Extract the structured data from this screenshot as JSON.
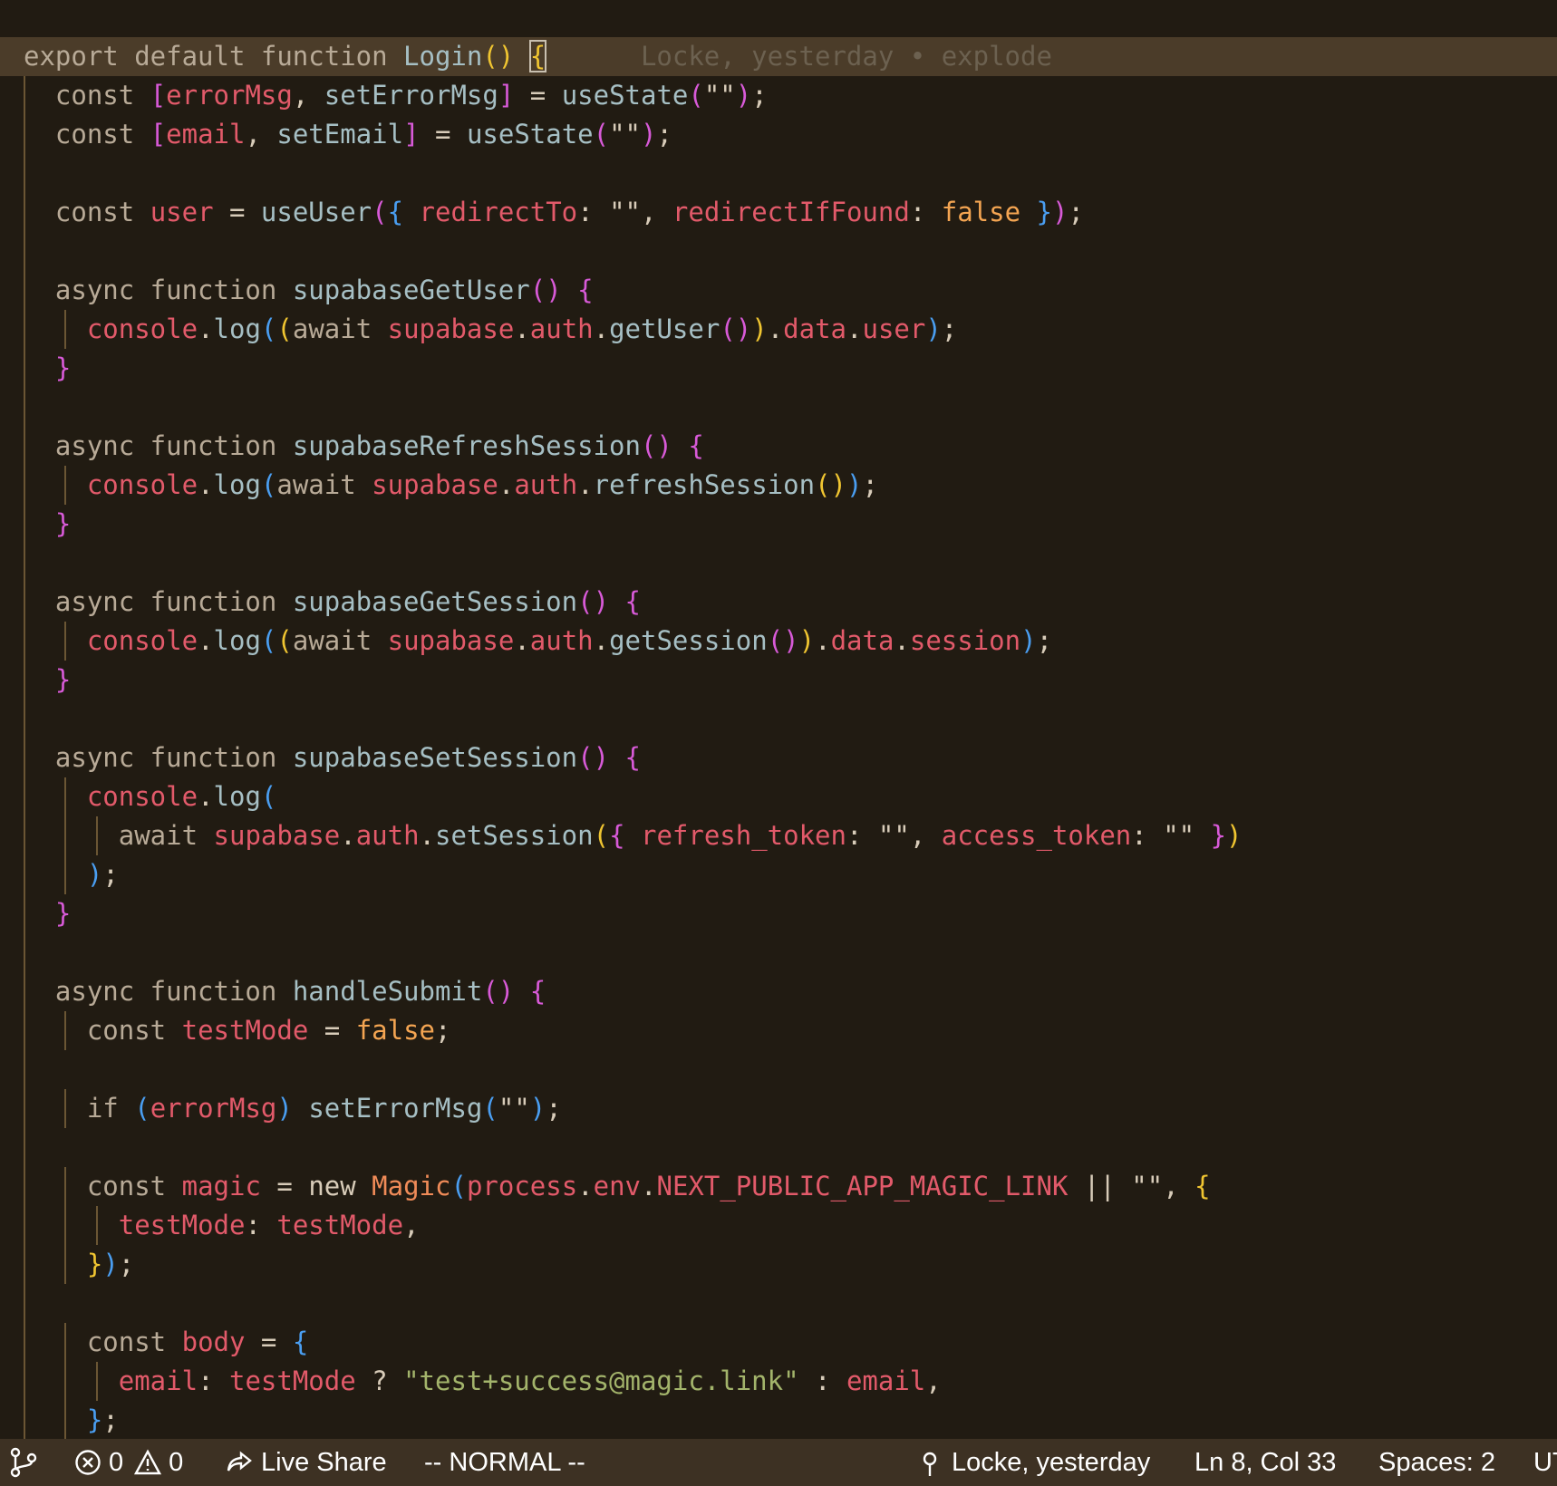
{
  "theme": {
    "bg": "#211b12",
    "current_line_bg": "#4b3c29",
    "statusbar_bg": "#3d3123",
    "keyword": "#b8aa97",
    "plain": "#d8ccb9",
    "func": "#a6bfc4",
    "var": "#e25a6a",
    "bool": "#f4a552",
    "string": "#d8ccb9",
    "string_green": "#a3b46b",
    "bracket_yellow": "#f0c531",
    "bracket_magenta": "#d85ad8",
    "bracket_blue": "#4a9ef1",
    "class": "#f08b58"
  },
  "editor": {
    "blame_inline": "Locke, yesterday • explode",
    "lines": [
      {
        "indent": 0,
        "current": true,
        "tokens": [
          [
            "export default function ",
            "keyword"
          ],
          [
            "Login",
            "func"
          ],
          [
            "()",
            "bracket_yellow"
          ],
          [
            " ",
            "plain"
          ],
          [
            "{",
            "bracket_yellow",
            "cursor"
          ]
        ]
      },
      {
        "indent": 1,
        "tokens": [
          [
            "const ",
            "keyword"
          ],
          [
            "[",
            "bracket_magenta"
          ],
          [
            "errorMsg",
            "var"
          ],
          [
            ", ",
            "plain"
          ],
          [
            "setErrorMsg",
            "func"
          ],
          [
            "]",
            "bracket_magenta"
          ],
          [
            " = ",
            "plain"
          ],
          [
            "useState",
            "func"
          ],
          [
            "(",
            "bracket_magenta"
          ],
          [
            "\"\"",
            "string"
          ],
          [
            ")",
            "bracket_magenta"
          ],
          [
            ";",
            "plain"
          ]
        ]
      },
      {
        "indent": 1,
        "tokens": [
          [
            "const ",
            "keyword"
          ],
          [
            "[",
            "bracket_magenta"
          ],
          [
            "email",
            "var"
          ],
          [
            ", ",
            "plain"
          ],
          [
            "setEmail",
            "func"
          ],
          [
            "]",
            "bracket_magenta"
          ],
          [
            " = ",
            "plain"
          ],
          [
            "useState",
            "func"
          ],
          [
            "(",
            "bracket_magenta"
          ],
          [
            "\"\"",
            "string"
          ],
          [
            ")",
            "bracket_magenta"
          ],
          [
            ";",
            "plain"
          ]
        ]
      },
      {
        "indent": 0,
        "tokens": []
      },
      {
        "indent": 1,
        "tokens": [
          [
            "const ",
            "keyword"
          ],
          [
            "user",
            "var"
          ],
          [
            " = ",
            "plain"
          ],
          [
            "useUser",
            "func"
          ],
          [
            "(",
            "bracket_magenta"
          ],
          [
            "{ ",
            "bracket_blue"
          ],
          [
            "redirectTo",
            "var"
          ],
          [
            ": ",
            "plain"
          ],
          [
            "\"\"",
            "string"
          ],
          [
            ", ",
            "plain"
          ],
          [
            "redirectIfFound",
            "var"
          ],
          [
            ": ",
            "plain"
          ],
          [
            "false",
            "bool"
          ],
          [
            " }",
            "bracket_blue"
          ],
          [
            ")",
            "bracket_magenta"
          ],
          [
            ";",
            "plain"
          ]
        ]
      },
      {
        "indent": 0,
        "tokens": []
      },
      {
        "indent": 1,
        "tokens": [
          [
            "async function ",
            "keyword"
          ],
          [
            "supabaseGetUser",
            "func"
          ],
          [
            "()",
            "bracket_magenta"
          ],
          [
            " ",
            "plain"
          ],
          [
            "{",
            "bracket_magenta"
          ]
        ]
      },
      {
        "indent": 2,
        "tokens": [
          [
            "console",
            "var"
          ],
          [
            ".",
            "plain"
          ],
          [
            "log",
            "func"
          ],
          [
            "(",
            "bracket_blue"
          ],
          [
            "(",
            "bracket_yellow"
          ],
          [
            "await ",
            "keyword"
          ],
          [
            "supabase",
            "var"
          ],
          [
            ".",
            "plain"
          ],
          [
            "auth",
            "var"
          ],
          [
            ".",
            "plain"
          ],
          [
            "getUser",
            "func"
          ],
          [
            "()",
            "bracket_magenta"
          ],
          [
            ")",
            "bracket_yellow"
          ],
          [
            ".",
            "plain"
          ],
          [
            "data",
            "var"
          ],
          [
            ".",
            "plain"
          ],
          [
            "user",
            "var"
          ],
          [
            ")",
            "bracket_blue"
          ],
          [
            ";",
            "plain"
          ]
        ]
      },
      {
        "indent": 1,
        "tokens": [
          [
            "}",
            "bracket_magenta"
          ]
        ]
      },
      {
        "indent": 0,
        "tokens": []
      },
      {
        "indent": 1,
        "tokens": [
          [
            "async function ",
            "keyword"
          ],
          [
            "supabaseRefreshSession",
            "func"
          ],
          [
            "()",
            "bracket_magenta"
          ],
          [
            " ",
            "plain"
          ],
          [
            "{",
            "bracket_magenta"
          ]
        ]
      },
      {
        "indent": 2,
        "tokens": [
          [
            "console",
            "var"
          ],
          [
            ".",
            "plain"
          ],
          [
            "log",
            "func"
          ],
          [
            "(",
            "bracket_blue"
          ],
          [
            "await ",
            "keyword"
          ],
          [
            "supabase",
            "var"
          ],
          [
            ".",
            "plain"
          ],
          [
            "auth",
            "var"
          ],
          [
            ".",
            "plain"
          ],
          [
            "refreshSession",
            "func"
          ],
          [
            "()",
            "bracket_yellow"
          ],
          [
            ")",
            "bracket_blue"
          ],
          [
            ";",
            "plain"
          ]
        ]
      },
      {
        "indent": 1,
        "tokens": [
          [
            "}",
            "bracket_magenta"
          ]
        ]
      },
      {
        "indent": 0,
        "tokens": []
      },
      {
        "indent": 1,
        "tokens": [
          [
            "async function ",
            "keyword"
          ],
          [
            "supabaseGetSession",
            "func"
          ],
          [
            "()",
            "bracket_magenta"
          ],
          [
            " ",
            "plain"
          ],
          [
            "{",
            "bracket_magenta"
          ]
        ]
      },
      {
        "indent": 2,
        "tokens": [
          [
            "console",
            "var"
          ],
          [
            ".",
            "plain"
          ],
          [
            "log",
            "func"
          ],
          [
            "(",
            "bracket_blue"
          ],
          [
            "(",
            "bracket_yellow"
          ],
          [
            "await ",
            "keyword"
          ],
          [
            "supabase",
            "var"
          ],
          [
            ".",
            "plain"
          ],
          [
            "auth",
            "var"
          ],
          [
            ".",
            "plain"
          ],
          [
            "getSession",
            "func"
          ],
          [
            "()",
            "bracket_magenta"
          ],
          [
            ")",
            "bracket_yellow"
          ],
          [
            ".",
            "plain"
          ],
          [
            "data",
            "var"
          ],
          [
            ".",
            "plain"
          ],
          [
            "session",
            "var"
          ],
          [
            ")",
            "bracket_blue"
          ],
          [
            ";",
            "plain"
          ]
        ]
      },
      {
        "indent": 1,
        "tokens": [
          [
            "}",
            "bracket_magenta"
          ]
        ]
      },
      {
        "indent": 0,
        "tokens": []
      },
      {
        "indent": 1,
        "tokens": [
          [
            "async function ",
            "keyword"
          ],
          [
            "supabaseSetSession",
            "func"
          ],
          [
            "()",
            "bracket_magenta"
          ],
          [
            " ",
            "plain"
          ],
          [
            "{",
            "bracket_magenta"
          ]
        ]
      },
      {
        "indent": 2,
        "tokens": [
          [
            "console",
            "var"
          ],
          [
            ".",
            "plain"
          ],
          [
            "log",
            "func"
          ],
          [
            "(",
            "bracket_blue"
          ]
        ]
      },
      {
        "indent": 3,
        "tokens": [
          [
            "await ",
            "keyword"
          ],
          [
            "supabase",
            "var"
          ],
          [
            ".",
            "plain"
          ],
          [
            "auth",
            "var"
          ],
          [
            ".",
            "plain"
          ],
          [
            "setSession",
            "func"
          ],
          [
            "(",
            "bracket_yellow"
          ],
          [
            "{ ",
            "bracket_magenta"
          ],
          [
            "refresh_token",
            "var"
          ],
          [
            ": ",
            "plain"
          ],
          [
            "\"\"",
            "string"
          ],
          [
            ", ",
            "plain"
          ],
          [
            "access_token",
            "var"
          ],
          [
            ": ",
            "plain"
          ],
          [
            "\"\" ",
            "string"
          ],
          [
            "}",
            "bracket_magenta"
          ],
          [
            ")",
            "bracket_yellow"
          ]
        ]
      },
      {
        "indent": 2,
        "tokens": [
          [
            ")",
            "bracket_blue"
          ],
          [
            ";",
            "plain"
          ]
        ]
      },
      {
        "indent": 1,
        "tokens": [
          [
            "}",
            "bracket_magenta"
          ]
        ]
      },
      {
        "indent": 0,
        "tokens": []
      },
      {
        "indent": 1,
        "tokens": [
          [
            "async function ",
            "keyword"
          ],
          [
            "handleSubmit",
            "func"
          ],
          [
            "()",
            "bracket_magenta"
          ],
          [
            " ",
            "plain"
          ],
          [
            "{",
            "bracket_magenta"
          ]
        ]
      },
      {
        "indent": 2,
        "tokens": [
          [
            "const ",
            "keyword"
          ],
          [
            "testMode",
            "var"
          ],
          [
            " = ",
            "plain"
          ],
          [
            "false",
            "bool"
          ],
          [
            ";",
            "plain"
          ]
        ]
      },
      {
        "indent": 0,
        "tokens": []
      },
      {
        "indent": 2,
        "tokens": [
          [
            "if ",
            "keyword"
          ],
          [
            "(",
            "bracket_blue"
          ],
          [
            "errorMsg",
            "var"
          ],
          [
            ")",
            "bracket_blue"
          ],
          [
            " ",
            "plain"
          ],
          [
            "setErrorMsg",
            "func"
          ],
          [
            "(",
            "bracket_blue"
          ],
          [
            "\"\"",
            "string"
          ],
          [
            ")",
            "bracket_blue"
          ],
          [
            ";",
            "plain"
          ]
        ]
      },
      {
        "indent": 0,
        "tokens": []
      },
      {
        "indent": 2,
        "tokens": [
          [
            "const ",
            "keyword"
          ],
          [
            "magic",
            "var"
          ],
          [
            " = ",
            "plain"
          ],
          [
            "new ",
            "plain"
          ],
          [
            "Magic",
            "class"
          ],
          [
            "(",
            "bracket_blue"
          ],
          [
            "process",
            "var"
          ],
          [
            ".",
            "plain"
          ],
          [
            "env",
            "var"
          ],
          [
            ".",
            "plain"
          ],
          [
            "NEXT_PUBLIC_APP_MAGIC_LINK",
            "var"
          ],
          [
            " || ",
            "plain"
          ],
          [
            "\"\"",
            "string"
          ],
          [
            ", ",
            "plain"
          ],
          [
            "{",
            "bracket_yellow"
          ]
        ]
      },
      {
        "indent": 3,
        "tokens": [
          [
            "testMode",
            "var"
          ],
          [
            ": ",
            "plain"
          ],
          [
            "testMode",
            "var"
          ],
          [
            ",",
            "plain"
          ]
        ]
      },
      {
        "indent": 2,
        "tokens": [
          [
            "}",
            "bracket_yellow"
          ],
          [
            ")",
            "bracket_blue"
          ],
          [
            ";",
            "plain"
          ]
        ]
      },
      {
        "indent": 0,
        "tokens": []
      },
      {
        "indent": 2,
        "tokens": [
          [
            "const ",
            "keyword"
          ],
          [
            "body",
            "var"
          ],
          [
            " = ",
            "plain"
          ],
          [
            "{",
            "bracket_blue"
          ]
        ]
      },
      {
        "indent": 3,
        "tokens": [
          [
            "email",
            "var"
          ],
          [
            ": ",
            "plain"
          ],
          [
            "testMode",
            "var"
          ],
          [
            " ? ",
            "plain"
          ],
          [
            "\"test+success@magic.link\"",
            "string_green"
          ],
          [
            " : ",
            "plain"
          ],
          [
            "email",
            "var"
          ],
          [
            ",",
            "plain"
          ]
        ]
      },
      {
        "indent": 2,
        "tokens": [
          [
            "}",
            "bracket_blue"
          ],
          [
            ";",
            "plain"
          ]
        ]
      }
    ]
  },
  "statusbar": {
    "errors": "0",
    "warnings": "0",
    "live_share": "Live Share",
    "mode": "-- NORMAL --",
    "blame": "Locke, yesterday",
    "cursor_pos": "Ln 8, Col 33",
    "spaces": "Spaces: 2",
    "encoding": "UT"
  }
}
